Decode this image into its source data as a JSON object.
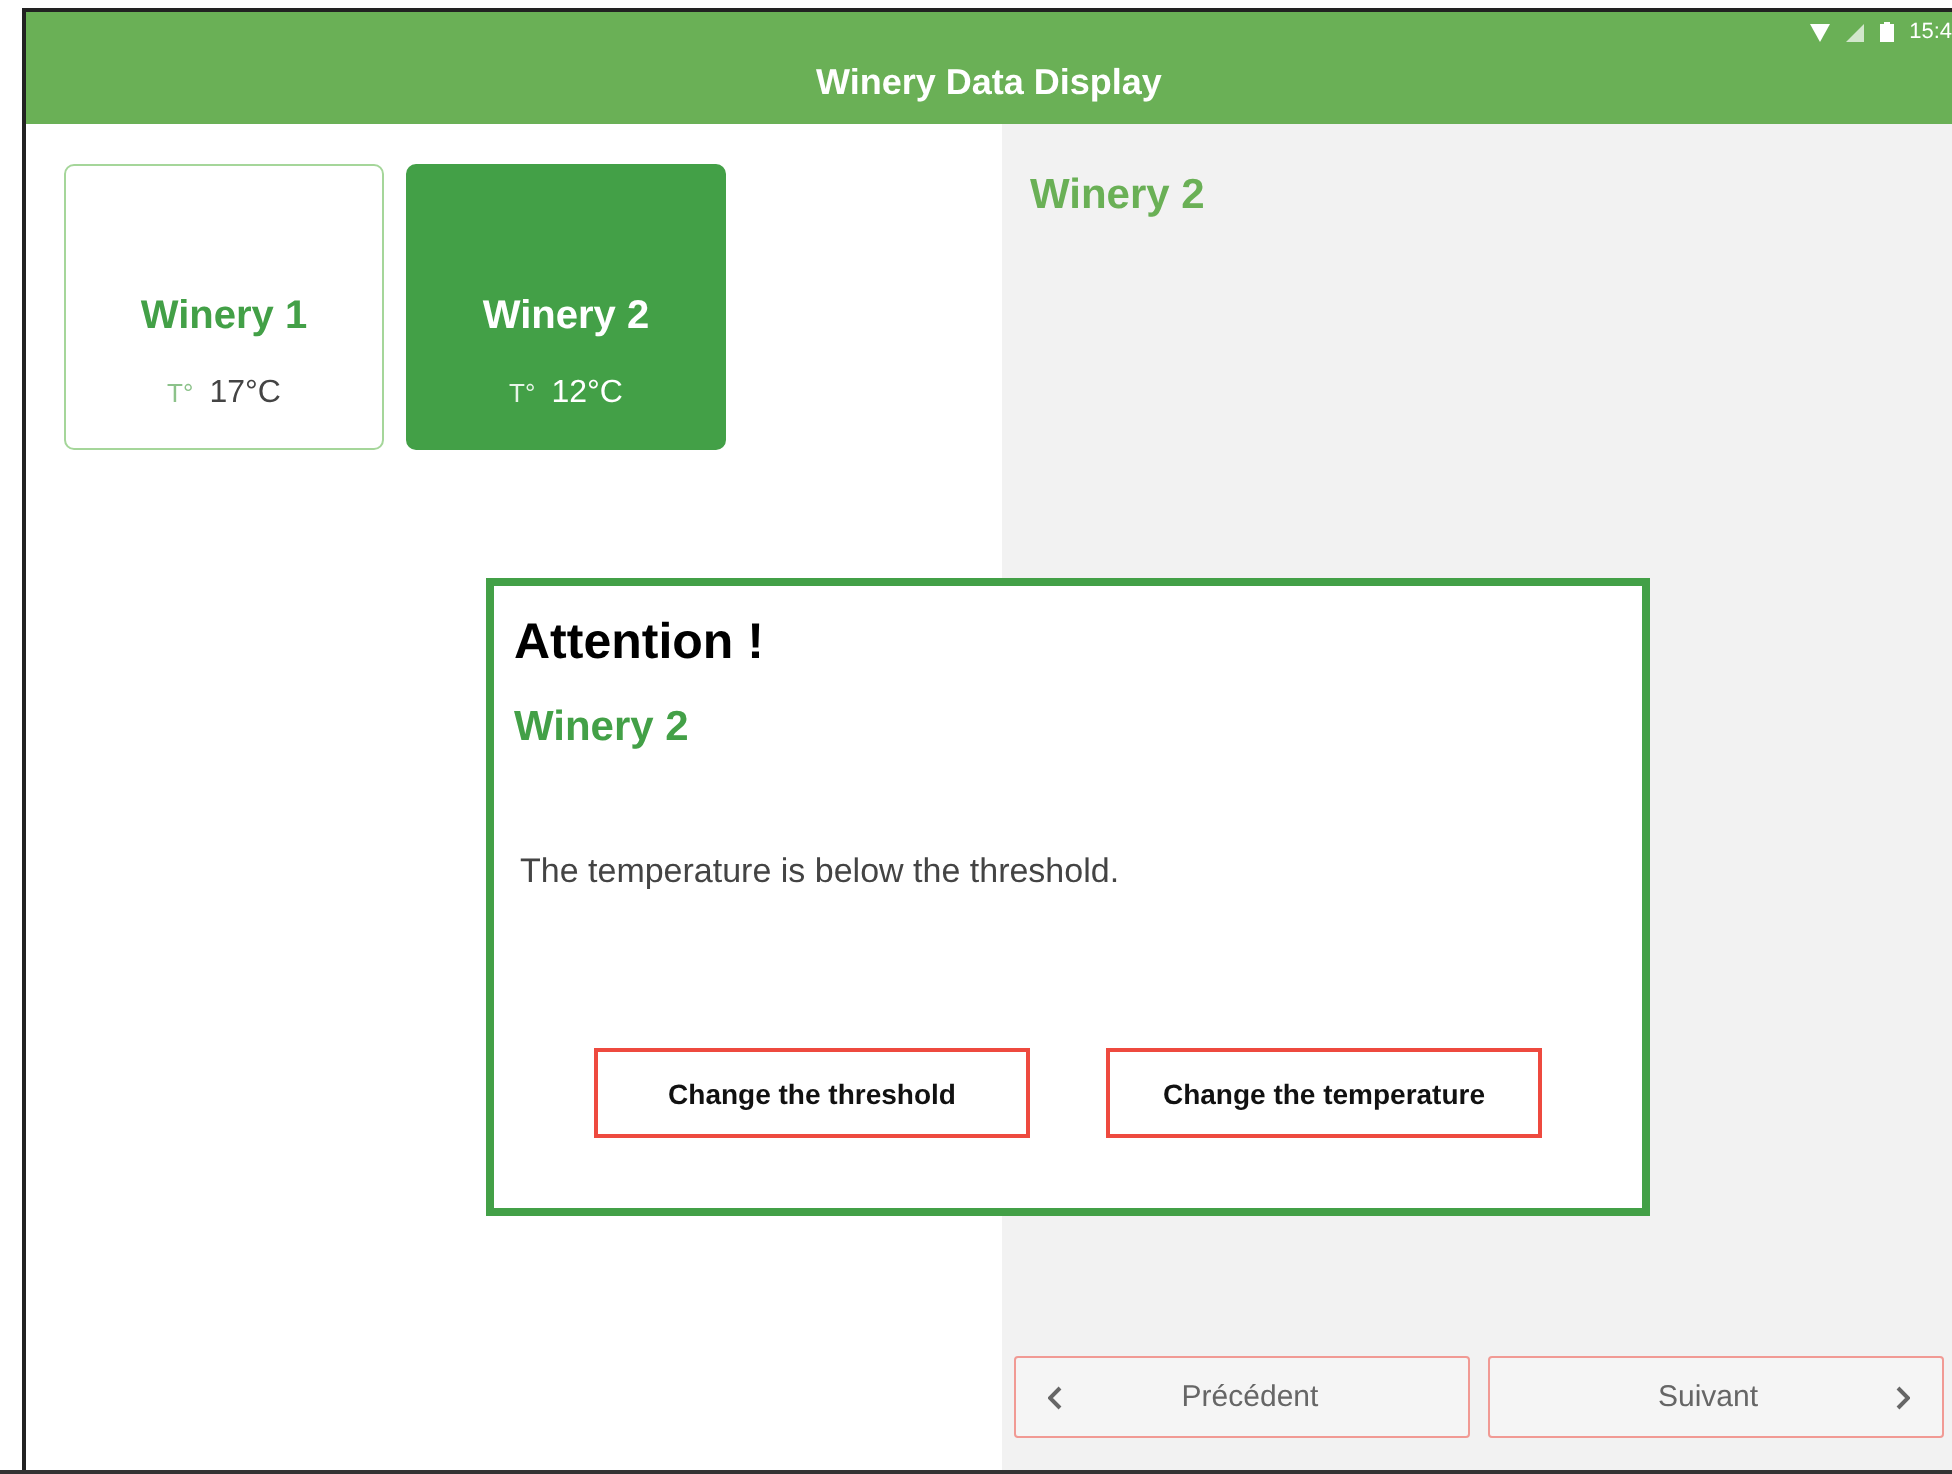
{
  "status_bar": {
    "time": "15:4"
  },
  "header": {
    "title": "Winery Data Display"
  },
  "wineries": [
    {
      "name": "Winery 1",
      "temp_label": "T°",
      "temp": "17°C",
      "selected": false
    },
    {
      "name": "Winery 2",
      "temp_label": "T°",
      "temp": "12°C",
      "selected": true
    }
  ],
  "detail": {
    "title": "Winery 2"
  },
  "dialog": {
    "title": "Attention !",
    "subtitle": "Winery 2",
    "message": "The temperature is below the threshold.",
    "buttons": [
      "Change the threshold",
      "Change the temperature"
    ]
  },
  "nav": {
    "previous": "Précédent",
    "next": "Suivant"
  }
}
